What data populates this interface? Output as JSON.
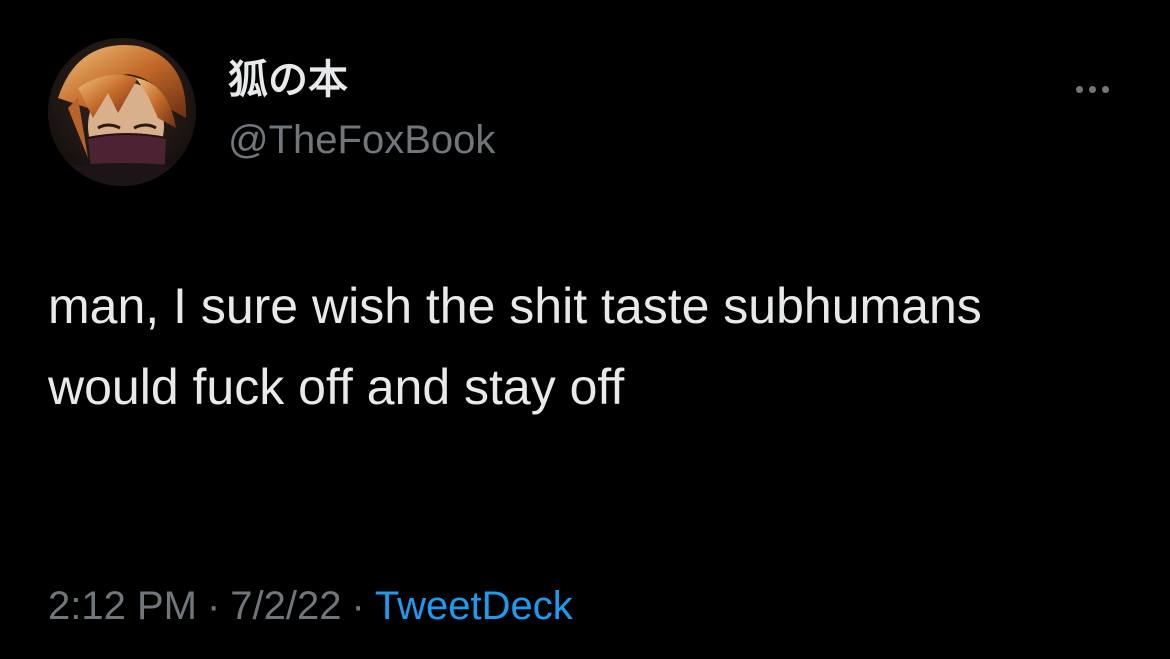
{
  "tweet": {
    "author": {
      "display_name": "狐の本",
      "handle": "@TheFoxBook",
      "avatar_icon": "profile-avatar"
    },
    "more_icon": "more-horizontal-icon",
    "text": "man, I sure wish the shit taste subhumans would fuck off and stay off",
    "time": "2:12 PM",
    "separator": "·",
    "date": "7/2/22",
    "source": "TweetDeck"
  },
  "colors": {
    "background": "#000000",
    "primary_text": "#e7e9ea",
    "secondary_text": "#71767b",
    "link": "#1d9bf0"
  }
}
